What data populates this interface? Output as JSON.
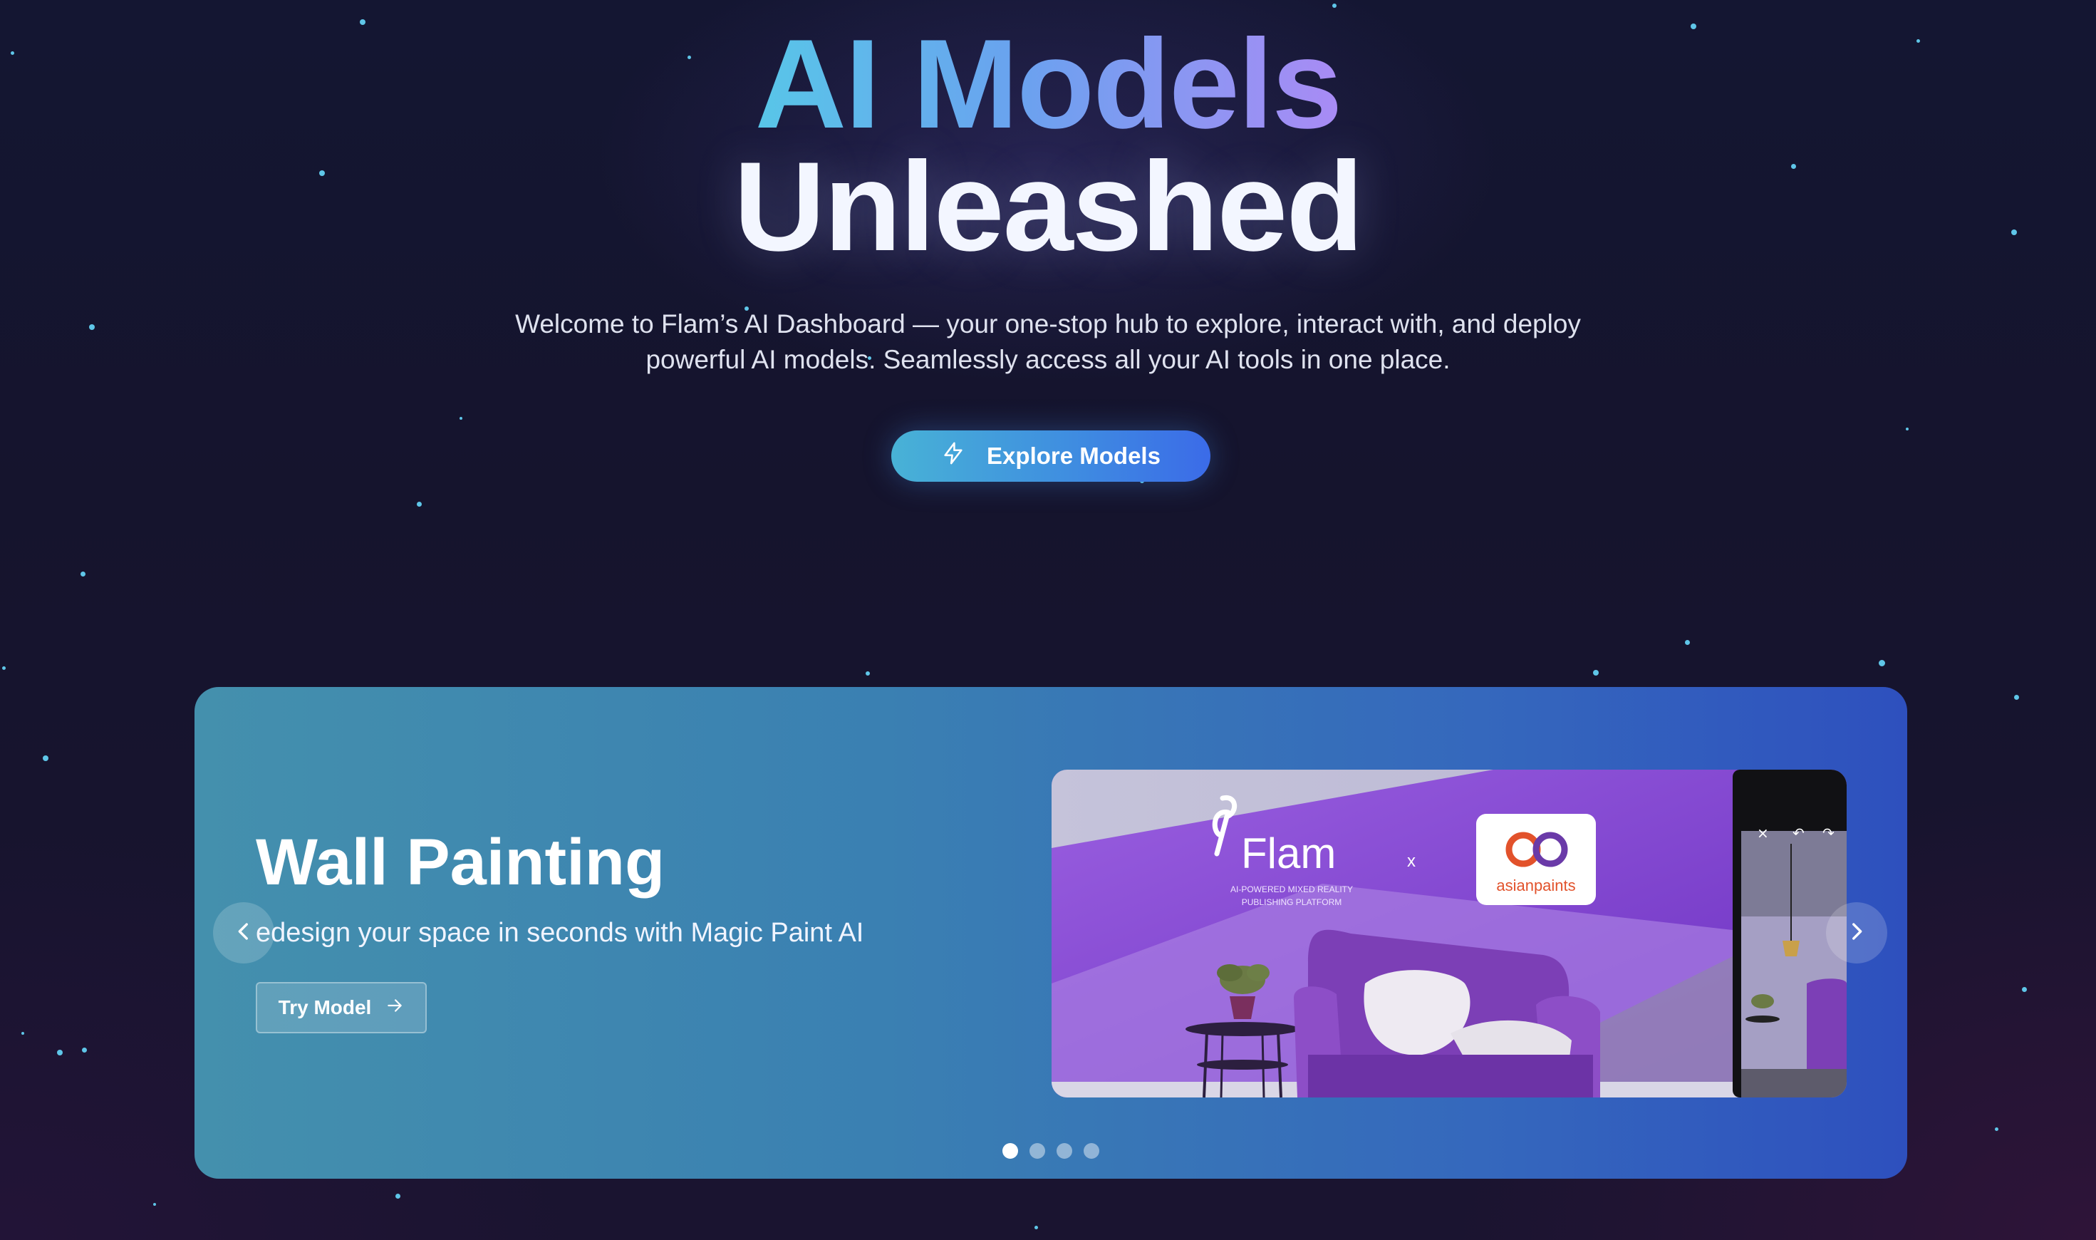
{
  "hero": {
    "title_line1": "AI Models",
    "title_line2": "Unleashed",
    "subtitle_line1": "Welcome to Flam’s AI Dashboard — your one-stop hub to explore, interact with, and deploy",
    "subtitle_line2": "powerful AI models. Seamlessly access all your AI tools in one place.",
    "explore_button": {
      "label": "Explore Models",
      "icon": "lightning-icon"
    }
  },
  "carousel": {
    "slide": {
      "title": "Wall Painting",
      "description": "edesign your space in seconds with Magic Paint AI",
      "try_button": {
        "label": "Try Model",
        "icon": "arrow-right-icon"
      },
      "image": {
        "brand_name": "Flam",
        "brand_tagline_1": "AI-POWERED MIXED REALITY",
        "brand_tagline_2": "PUBLISHING PLATFORM",
        "separator": "x",
        "partner_logo_text": "asianpaints"
      }
    },
    "prev_icon": "chevron-left-icon",
    "next_icon": "chevron-right-icon",
    "pagination": {
      "total": 4,
      "active_index": 0
    }
  },
  "colors": {
    "background": "#15142d",
    "title_gradient_start": "#58c6e8",
    "title_gradient_end": "#a98bf5",
    "card_gradient_start": "#4490ad",
    "card_gradient_end": "#2e50be",
    "star": "#5fc6e8"
  }
}
